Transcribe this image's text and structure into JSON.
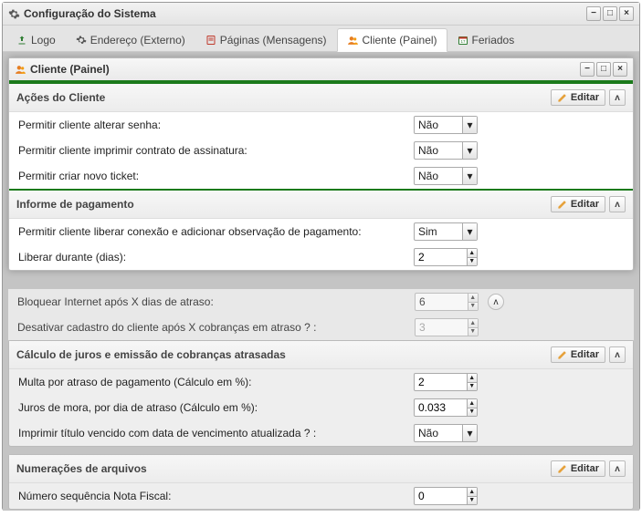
{
  "window": {
    "title": "Configuração do Sistema"
  },
  "tabs": {
    "logo": "Logo",
    "endereco": "Endereço (Externo)",
    "paginas": "Páginas (Mensagens)",
    "cliente": "Cliente (Painel)",
    "feriados": "Feriados"
  },
  "panel": {
    "title": "Cliente (Painel)"
  },
  "edit_label": "Editar",
  "sections": {
    "acoes": {
      "title": "Ações do Cliente",
      "row1": {
        "label": "Permitir cliente alterar senha:",
        "value": "Não"
      },
      "row2": {
        "label": "Permitir cliente imprimir contrato de assinatura:",
        "value": "Não"
      },
      "row3": {
        "label": "Permitir criar novo ticket:",
        "value": "Não"
      }
    },
    "pagamento": {
      "title": "Informe de pagamento",
      "row1": {
        "label": "Permitir cliente liberar conexão e adicionar observação de pagamento:",
        "value": "Sim"
      },
      "row2": {
        "label": "Liberar durante (dias):",
        "value": "2"
      }
    }
  },
  "bg": {
    "row_bloq": {
      "label": "Bloquear Internet após X dias de atraso:",
      "value": "6"
    },
    "row_desat": {
      "label": "Desativar cadastro do cliente após X cobranças em atraso ? :",
      "value": "3"
    },
    "calc": {
      "title": "Cálculo de juros e emissão de cobranças atrasadas",
      "row1": {
        "label": "Multa por atraso de pagamento (Cálculo em %):",
        "value": "2"
      },
      "row2": {
        "label": "Juros de mora, por dia de atraso (Cálculo em %):",
        "value": "0.033"
      },
      "row3": {
        "label": "Imprimir título vencido com data de vencimento atualizada ? :",
        "value": "Não"
      }
    },
    "num": {
      "title": "Numerações de arquivos",
      "row1": {
        "label": "Número sequência Nota Fiscal:",
        "value": "0"
      }
    }
  }
}
